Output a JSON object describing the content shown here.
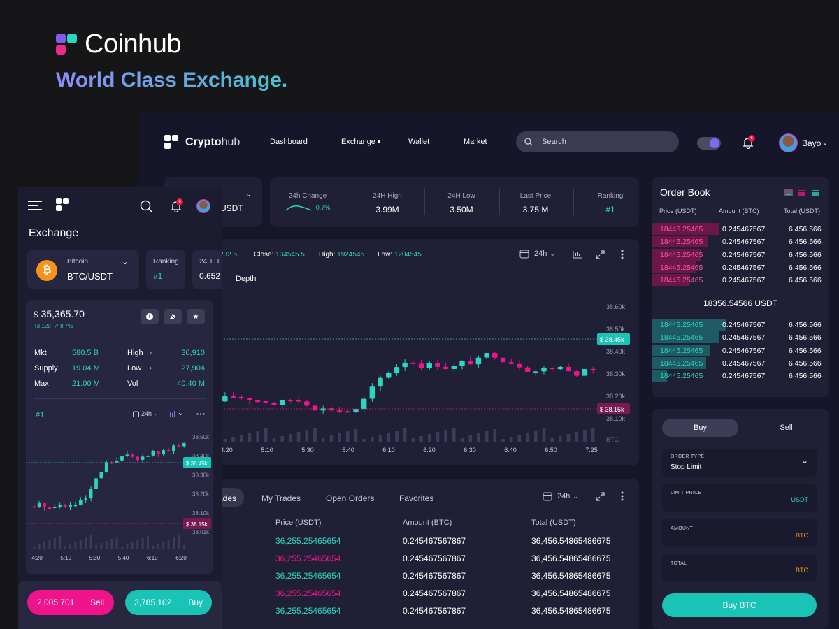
{
  "brand": {
    "name": "Coinhub",
    "tagline": "World Class Exchange."
  },
  "app": {
    "logo_bold": "Crypto",
    "logo_light": "hub",
    "nav": [
      "Dashboard",
      "Exchange",
      "Wallet",
      "Market"
    ],
    "search_placeholder": "Search",
    "user_name": "Bayo",
    "notification_badge": "6"
  },
  "pair": {
    "quote": "USDT"
  },
  "stats": [
    {
      "label": "24h Change",
      "value": "0.7%"
    },
    {
      "label": "24H High",
      "value": "3.99M"
    },
    {
      "label": "24H Low",
      "value": "3.50M"
    },
    {
      "label": "Last Price",
      "value": "3.75 M"
    },
    {
      "label": "Ranking",
      "value": "#1"
    }
  ],
  "chart_header": {
    "open_fragment": "232.5",
    "close_label": "Close:",
    "close_value": "134545.5",
    "high_label": "High:",
    "high_value": "1924545",
    "low_label": "Low:",
    "low_value": "1204545",
    "interval": "24h",
    "depth_tab": "Depth"
  },
  "chart_data": {
    "type": "candlestick",
    "x_ticks": [
      "4:20",
      "5:10",
      "5:30",
      "5:40",
      "6:10",
      "6:20",
      "6:30",
      "6:40",
      "6:50",
      "7:25"
    ],
    "y_ticks": [
      "38.60k",
      "38.50k",
      "38.40k",
      "38.30k",
      "38.20k",
      "38.10k"
    ],
    "volume_axis_label": "BTC",
    "price_tag_high": "$ 38.45k",
    "price_tag_low": "$ 38.15k",
    "ylim": [
      38100,
      38650
    ]
  },
  "order_book": {
    "title": "Order Book",
    "headers": [
      "Price (USDT)",
      "Amount (BTC)",
      "Total (USDT)"
    ],
    "asks": [
      {
        "price": "18445.25465",
        "amount": "0.245467567",
        "total": "6,456.566",
        "depth": 0.82
      },
      {
        "price": "18445.25465",
        "amount": "0.245467567",
        "total": "6,456.566",
        "depth": 0.68
      },
      {
        "price": "18445.25465",
        "amount": "0.245467567",
        "total": "6,456.566",
        "depth": 0.6
      },
      {
        "price": "18445.25465",
        "amount": "0.245467567",
        "total": "6,456.566",
        "depth": 0.53
      },
      {
        "price": "18445.25465",
        "amount": "0.245467567",
        "total": "6,456.566",
        "depth": 0.47
      }
    ],
    "mid_price": "18356.54566 USDT",
    "bids": [
      {
        "price": "18445.25465",
        "amount": "0.245467567",
        "total": "6,456.566",
        "depth": 0.9
      },
      {
        "price": "18445.25465",
        "amount": "0.245467567",
        "total": "6,456.566",
        "depth": 0.82
      },
      {
        "price": "18445.25465",
        "amount": "0.245467567",
        "total": "6,456.566",
        "depth": 0.71
      },
      {
        "price": "18445.25465",
        "amount": "0.245467567",
        "total": "6,456.566",
        "depth": 0.66
      },
      {
        "price": "18445.25465",
        "amount": "0.245467567",
        "total": "6,456.566",
        "depth": 0.19
      }
    ]
  },
  "order_form": {
    "buy_tab": "Buy",
    "sell_tab": "Sell",
    "order_type_label": "ORDER TYPE",
    "order_type_value": "Stop Limit",
    "limit_price_label": "LIMIT PRICE",
    "limit_price_unit": "USDT",
    "amount_label": "AMOUNT",
    "amount_unit": "BTC",
    "total_label": "TOTAL",
    "total_unit": "BTC",
    "submit": "Buy BTC"
  },
  "trades": {
    "tabs": [
      "ades",
      "My Trades",
      "Open Orders",
      "Favorites"
    ],
    "interval": "24h",
    "headers": [
      "Price (USDT)",
      "Amount (BTC)",
      "Total (USDT)"
    ],
    "rows": [
      {
        "price": "36,255.25465654",
        "amount": "0.245467567867",
        "total": "36,456.54865486675",
        "side": "buy"
      },
      {
        "price": "36,255.25465654",
        "amount": "0.245467567867",
        "total": "36,456.54865486675",
        "side": "sell"
      },
      {
        "price": "36,255.25465654",
        "amount": "0.245467567867",
        "total": "36,456.54865486675",
        "side": "buy"
      },
      {
        "price": "36,255.25465654",
        "amount": "0.245467567867",
        "total": "36,456.54865486675",
        "side": "sell"
      },
      {
        "price": "36,255.25465654",
        "amount": "0.245467567867",
        "total": "36,456.54865486675",
        "side": "buy"
      }
    ]
  },
  "mobile": {
    "notification_badge": "6",
    "title": "Exchange",
    "coin_name": "Bitcoin",
    "pair": "BTC/USDT",
    "ranking_label": "Ranking",
    "ranking_value": "#1",
    "high_label": "24H Hi",
    "high_value": "0.652",
    "price_symbol": "$",
    "price": "35,365.70",
    "change_abs": "+3,120",
    "change_pct": "8.7%",
    "stats": [
      {
        "label": "Mkt",
        "value": "580.5 B",
        "label2": "High",
        "value2": "30,910"
      },
      {
        "label": "Supply",
        "value": "19.04 M",
        "label2": "Low",
        "value2": "27,904"
      },
      {
        "label": "Max",
        "value": "21.00 M",
        "label2": "Vol",
        "value2": "40.40 M"
      }
    ],
    "rank_tag": "#1",
    "interval": "24h",
    "chart_data": {
      "type": "candlestick",
      "x_ticks": [
        "4:20",
        "5:10",
        "5:30",
        "5:40",
        "6:10",
        "6:20"
      ],
      "y_ticks": [
        "38.50k",
        "38.40k",
        "38.30k",
        "38.20k",
        "38.10k",
        "38.01k"
      ],
      "price_tag_high": "$ 38.45k",
      "price_tag_low": "$ 38.15k"
    },
    "sell_value": "2,005.701",
    "sell_label": "Sell",
    "buy_value": "3,785.102",
    "buy_label": "Buy"
  },
  "colors": {
    "accent_green": "#2dd4bf",
    "accent_pink": "#f0148c",
    "panel": "#1f1f35",
    "brand_pink": "#ec2a8e",
    "brand_blue": "#5b5bf0"
  }
}
